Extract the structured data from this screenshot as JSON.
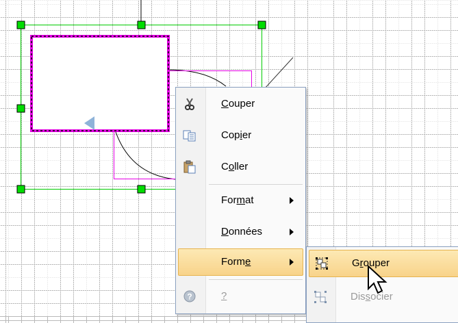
{
  "context_menu": {
    "items": [
      {
        "id": "couper",
        "pre": "",
        "key": "C",
        "post": "ouper",
        "icon": "scissors-icon"
      },
      {
        "id": "copier",
        "pre": "Cop",
        "key": "i",
        "post": "er",
        "icon": "copy-icon"
      },
      {
        "id": "coller",
        "pre": "C",
        "key": "o",
        "post": "ller",
        "icon": "paste-icon"
      },
      {
        "id": "format",
        "pre": "For",
        "key": "m",
        "post": "at",
        "submenu": true
      },
      {
        "id": "donnees",
        "pre": "",
        "key": "D",
        "post": "onnées",
        "submenu": true
      },
      {
        "id": "forme",
        "pre": "Form",
        "key": "e",
        "post": "",
        "submenu": true,
        "highlighted": true
      },
      {
        "id": "aide",
        "pre": "",
        "key": "?",
        "post": "",
        "icon": "help-icon",
        "disabled": true
      }
    ]
  },
  "submenu": {
    "items": [
      {
        "id": "grouper",
        "pre": "G",
        "key": "r",
        "post": "ouper",
        "icon": "group-icon",
        "highlighted": true
      },
      {
        "id": "dissocier",
        "pre": "Dis",
        "key": "s",
        "post": "ocier",
        "icon": "ungroup-icon",
        "disabled": true
      }
    ]
  },
  "colors": {
    "selection": "#00cc00",
    "shape_border": "#e600e6",
    "highlight": "#fbe3a4",
    "handle": "#00cc00"
  }
}
